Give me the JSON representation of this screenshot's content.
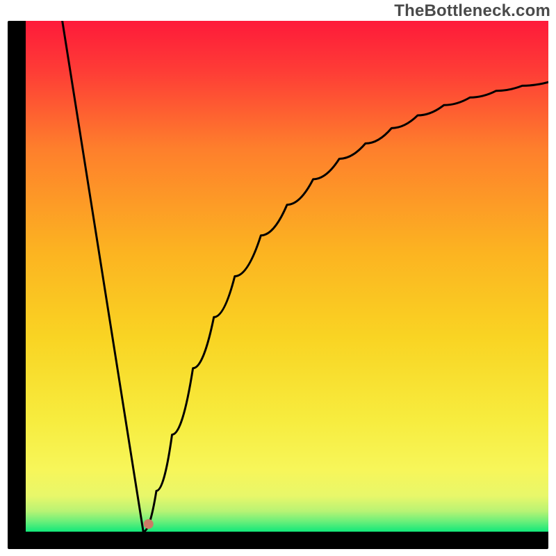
{
  "watermark": "TheBottleneck.com",
  "colors": {
    "frame": "#000000",
    "gradient_top": "#fe1a3a",
    "gradient_mid1": "#fe7f2c",
    "gradient_mid2": "#f9d423",
    "gradient_mid3": "#f7f65a",
    "gradient_bottom": "#12e87a",
    "curve": "#000000",
    "dot": "#cc7a66"
  },
  "chart_data": {
    "type": "line",
    "title": "",
    "xlabel": "",
    "ylabel": "",
    "x_range": [
      0,
      100
    ],
    "y_range": [
      0,
      100
    ],
    "left_segment": {
      "x": [
        7,
        22.5
      ],
      "y": [
        100,
        0
      ]
    },
    "right_curve": {
      "x": [
        22.5,
        25,
        28,
        32,
        36,
        40,
        45,
        50,
        55,
        60,
        65,
        70,
        75,
        80,
        85,
        90,
        95,
        100
      ],
      "y": [
        0,
        8,
        19,
        32,
        42,
        50,
        58,
        64,
        69,
        73,
        76,
        79,
        81.5,
        83.5,
        85,
        86.3,
        87.3,
        88
      ]
    },
    "marker": {
      "x": 23.5,
      "y": 1.5
    },
    "note": "V-shaped bottleneck curve; linear descent to a sharp minimum near x≈23, then asymptotic rise toward y≈88."
  }
}
